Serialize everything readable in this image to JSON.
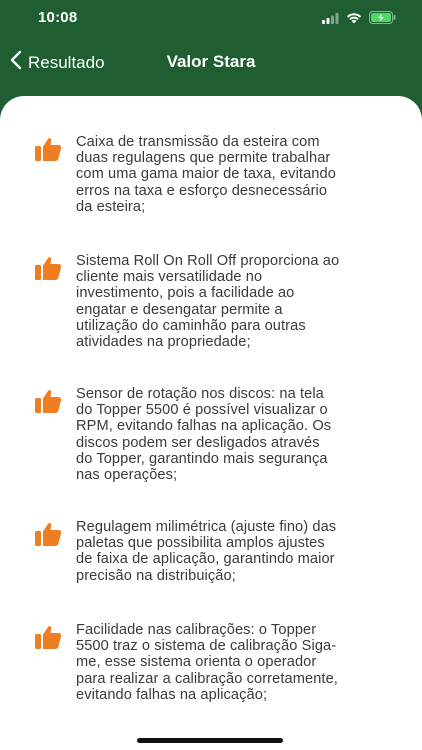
{
  "status_bar": {
    "time": "10:08",
    "icons": [
      "signal-icon",
      "wifi-icon",
      "battery-charging-icon"
    ],
    "battery_color": "#4cd964"
  },
  "nav": {
    "back_label": "Resultado",
    "title": "Valor Stara"
  },
  "colors": {
    "header_green": "#1e5e31",
    "thumb_orange": "#ef7d22",
    "text_gray": "#3a3a3a"
  },
  "features": [
    {
      "icon": "thumbs-up-icon",
      "text": "Caixa de transmissão da esteira com\nduas regulagens que permite trabalhar\ncom uma gama maior de taxa, evitando\nerros na taxa e esforço desnecessário\nda esteira;"
    },
    {
      "icon": "thumbs-up-icon",
      "text": "Sistema Roll On Roll Off proporciona ao\ncliente mais versatilidade no\ninvestimento, pois a facilidade ao\nengatar e desengatar permite a\nutilização do caminhão para outras\natividades na propriedade;"
    },
    {
      "icon": "thumbs-up-icon",
      "text": "Sensor de rotação nos discos: na tela\ndo Topper 5500 é possível visualizar o\nRPM, evitando falhas na aplicação. Os\ndiscos podem ser desligados através\ndo Topper, garantindo mais segurança\nnas operações;"
    },
    {
      "icon": "thumbs-up-icon",
      "text": "Regulagem milimétrica (ajuste fino) das\npaletas que possibilita amplos ajustes\nde faixa de aplicação, garantindo maior\nprecisão na distribuição;"
    },
    {
      "icon": "thumbs-up-icon",
      "text": "Facilidade nas calibrações: o Topper\n5500 traz o sistema de calibração Siga-\nme, esse sistema orienta o operador\npara realizar a calibração corretamente,\nevitando falhas na aplicação;"
    }
  ]
}
